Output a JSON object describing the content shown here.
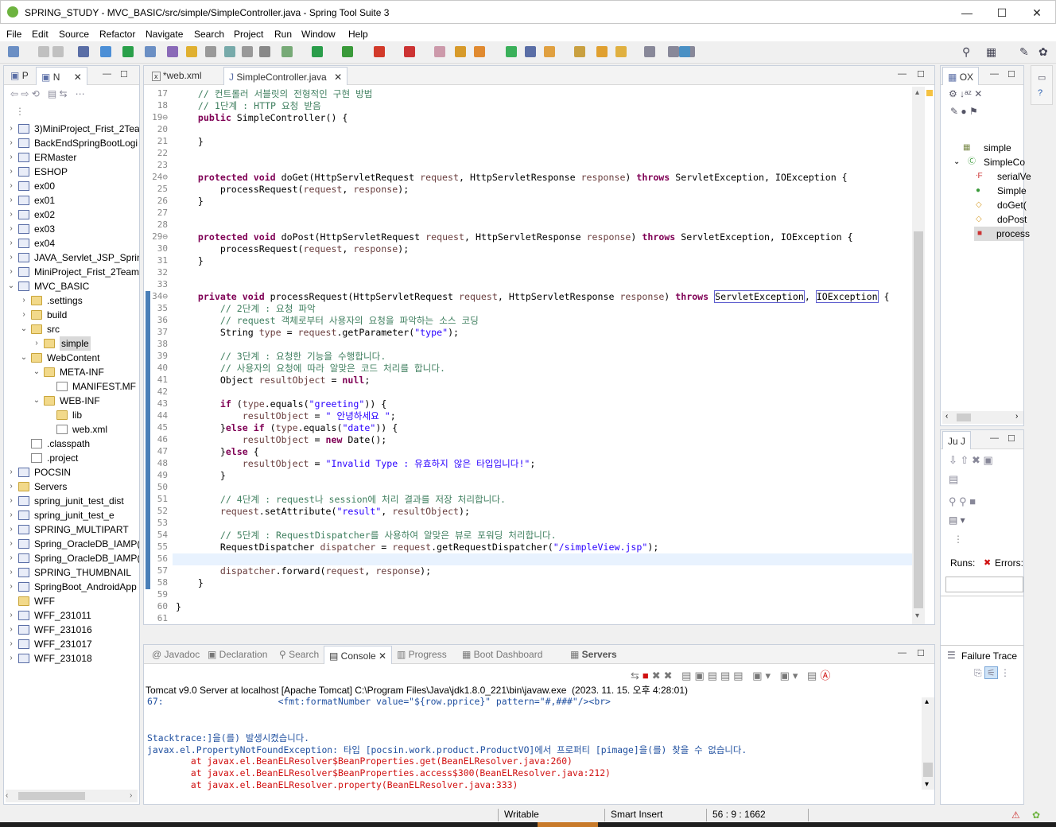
{
  "window": {
    "title": "SPRING_STUDY - MVC_BASIC/src/simple/SimpleController.java - Spring Tool Suite 3",
    "minimize": "—",
    "maximize": "☐",
    "close": "✕"
  },
  "menu": [
    "File",
    "Edit",
    "Source",
    "Refactor",
    "Navigate",
    "Search",
    "Project",
    "Run",
    "Window",
    "Help"
  ],
  "left_panel": {
    "tabs": [
      "P",
      "N"
    ],
    "tree": [
      {
        "label": "3)MiniProject_Frist_2Tea",
        "kind": "proj",
        "indent": 0,
        "arrow": ">"
      },
      {
        "label": "BackEndSpringBootLogi",
        "kind": "proj",
        "indent": 0,
        "arrow": ">"
      },
      {
        "label": "ERMaster",
        "kind": "proj",
        "indent": 0,
        "arrow": ">"
      },
      {
        "label": "ESHOP",
        "kind": "proj",
        "indent": 0,
        "arrow": ">"
      },
      {
        "label": "ex00",
        "kind": "proj",
        "indent": 0,
        "arrow": ">"
      },
      {
        "label": "ex01",
        "kind": "proj",
        "indent": 0,
        "arrow": ">"
      },
      {
        "label": "ex02",
        "kind": "proj",
        "indent": 0,
        "arrow": ">"
      },
      {
        "label": "ex03",
        "kind": "proj",
        "indent": 0,
        "arrow": ">"
      },
      {
        "label": "ex04",
        "kind": "proj",
        "indent": 0,
        "arrow": ">"
      },
      {
        "label": "JAVA_Servlet_JSP_Spring",
        "kind": "proj",
        "indent": 0,
        "arrow": ">"
      },
      {
        "label": "MiniProject_Frist_2Team",
        "kind": "proj",
        "indent": 0,
        "arrow": ">"
      },
      {
        "label": "MVC_BASIC",
        "kind": "proj",
        "indent": 0,
        "arrow": "v"
      },
      {
        "label": ".settings",
        "kind": "folder",
        "indent": 1,
        "arrow": ">"
      },
      {
        "label": "build",
        "kind": "folder",
        "indent": 1,
        "arrow": ">"
      },
      {
        "label": "src",
        "kind": "folder",
        "indent": 1,
        "arrow": "v"
      },
      {
        "label": "simple",
        "kind": "folder",
        "indent": 2,
        "arrow": ">",
        "selected": true
      },
      {
        "label": "WebContent",
        "kind": "folder",
        "indent": 1,
        "arrow": "v"
      },
      {
        "label": "META-INF",
        "kind": "folder",
        "indent": 2,
        "arrow": "v"
      },
      {
        "label": "MANIFEST.MF",
        "kind": "file",
        "indent": 3,
        "arrow": ""
      },
      {
        "label": "WEB-INF",
        "kind": "folder",
        "indent": 2,
        "arrow": "v"
      },
      {
        "label": "lib",
        "kind": "folder",
        "indent": 3,
        "arrow": ""
      },
      {
        "label": "web.xml",
        "kind": "file",
        "indent": 3,
        "arrow": ""
      },
      {
        "label": ".classpath",
        "kind": "file",
        "indent": 1,
        "arrow": ""
      },
      {
        "label": ".project",
        "kind": "file",
        "indent": 1,
        "arrow": ""
      },
      {
        "label": "POCSIN",
        "kind": "proj",
        "indent": 0,
        "arrow": ">"
      },
      {
        "label": "Servers",
        "kind": "folder",
        "indent": 0,
        "arrow": ">"
      },
      {
        "label": "spring_junit_test_dist",
        "kind": "proj",
        "indent": 0,
        "arrow": ">"
      },
      {
        "label": "spring_junit_test_e",
        "kind": "proj",
        "indent": 0,
        "arrow": ">"
      },
      {
        "label": "SPRING_MULTIPART",
        "kind": "proj",
        "indent": 0,
        "arrow": ">"
      },
      {
        "label": "Spring_OracleDB_IAMP(",
        "kind": "proj",
        "indent": 0,
        "arrow": ">"
      },
      {
        "label": "Spring_OracleDB_IAMP(",
        "kind": "proj",
        "indent": 0,
        "arrow": ">"
      },
      {
        "label": "SPRING_THUMBNAIL",
        "kind": "proj",
        "indent": 0,
        "arrow": ">"
      },
      {
        "label": "SpringBoot_AndroidApp",
        "kind": "proj",
        "indent": 0,
        "arrow": ">"
      },
      {
        "label": "WFF",
        "kind": "folder",
        "indent": 0,
        "arrow": ""
      },
      {
        "label": "WFF_231011",
        "kind": "proj",
        "indent": 0,
        "arrow": ">"
      },
      {
        "label": "WFF_231016",
        "kind": "proj",
        "indent": 0,
        "arrow": ">"
      },
      {
        "label": "WFF_231017",
        "kind": "proj",
        "indent": 0,
        "arrow": ">"
      },
      {
        "label": "WFF_231018",
        "kind": "proj",
        "indent": 0,
        "arrow": ">"
      }
    ]
  },
  "editor": {
    "tabs": [
      {
        "label": "*web.xml",
        "active": false
      },
      {
        "label": "SimpleController.java",
        "active": true
      }
    ],
    "lines": [
      {
        "n": "17",
        "html": "    <span class='cm'>// 컨트롤러 서블릿의 전형적인 구현 방법</span>"
      },
      {
        "n": "18",
        "html": "    <span class='cm'>// 1단계 : HTTP 요청 받음</span>"
      },
      {
        "n": "19⊖",
        "html": "    <span class='kw'>public</span> SimpleController() {"
      },
      {
        "n": "20",
        "html": ""
      },
      {
        "n": "21",
        "html": "    }"
      },
      {
        "n": "22",
        "html": ""
      },
      {
        "n": "23",
        "html": ""
      },
      {
        "n": "24⊖",
        "html": "    <span class='kw'>protected</span> <span class='kw'>void</span> doGet(HttpServletRequest <span class='var'>request</span>, HttpServletResponse <span class='var'>response</span>) <span class='kw'>throws</span> ServletException, IOException {"
      },
      {
        "n": "25",
        "html": "        processRequest(<span class='var'>request</span>, <span class='var'>response</span>);"
      },
      {
        "n": "26",
        "html": "    }"
      },
      {
        "n": "27",
        "html": ""
      },
      {
        "n": "28",
        "html": ""
      },
      {
        "n": "29⊖",
        "html": "    <span class='kw'>protected</span> <span class='kw'>void</span> doPost(HttpServletRequest <span class='var'>request</span>, HttpServletResponse <span class='var'>response</span>) <span class='kw'>throws</span> ServletException, IOException {"
      },
      {
        "n": "30",
        "html": "        processRequest(<span class='var'>request</span>, <span class='var'>response</span>);"
      },
      {
        "n": "31",
        "html": "    }"
      },
      {
        "n": "32",
        "html": ""
      },
      {
        "n": "33",
        "html": ""
      },
      {
        "n": "34⊖",
        "html": "    <span class='kw'>private</span> <span class='kw'>void</span> processRequest(HttpServletRequest <span class='var'>request</span>, HttpServletResponse <span class='var'>response</span>) <span class='kw'>throws</span> <span class='ul'>ServletException</span>, <span class='ul'>IOException</span> {"
      },
      {
        "n": "35",
        "html": "        <span class='cm'>// 2단계 : 요청 파악</span>"
      },
      {
        "n": "36",
        "html": "        <span class='cm'>// request 객체로부터 사용자의 요청을 파악하는 소스 코딩</span>"
      },
      {
        "n": "37",
        "html": "        String <span class='var'>type</span> = <span class='var'>request</span>.getParameter(<span class='st'>\"type\"</span>);"
      },
      {
        "n": "38",
        "html": ""
      },
      {
        "n": "39",
        "html": "        <span class='cm'>// 3단계 : 요청한 기능을 수행합니다.</span>"
      },
      {
        "n": "40",
        "html": "        <span class='cm'>// 사용자의 요청에 따라 알맞은 코드 처리를 합니다.</span>"
      },
      {
        "n": "41",
        "html": "        Object <span class='var'>resultObject</span> = <span class='kw'>null</span>;"
      },
      {
        "n": "42",
        "html": ""
      },
      {
        "n": "43",
        "html": "        <span class='kw'>if</span> (<span class='var'>type</span>.equals(<span class='st'>\"greeting\"</span>)) {"
      },
      {
        "n": "44",
        "html": "            <span class='var'>resultObject</span> = <span class='st'>\" 안녕하세요 \"</span>;"
      },
      {
        "n": "45",
        "html": "        }<span class='kw'>else</span> <span class='kw'>if</span> (<span class='var'>type</span>.equals(<span class='st'>\"date\"</span>)) {"
      },
      {
        "n": "46",
        "html": "            <span class='var'>resultObject</span> = <span class='kw'>new</span> Date();"
      },
      {
        "n": "47",
        "html": "        }<span class='kw'>else</span> {"
      },
      {
        "n": "48",
        "html": "            <span class='var'>resultObject</span> = <span class='st'>\"Invalid Type : 유효하지 않은 타입입니다!\"</span>;"
      },
      {
        "n": "49",
        "html": "        }"
      },
      {
        "n": "50",
        "html": ""
      },
      {
        "n": "51",
        "html": "        <span class='cm'>// 4단계 : request나 session에 처리 결과를 저장 처리합니다.</span>"
      },
      {
        "n": "52",
        "html": "        <span class='var'>request</span>.setAttribute(<span class='st'>\"result\"</span>, <span class='var'>resultObject</span>);"
      },
      {
        "n": "53",
        "html": ""
      },
      {
        "n": "54",
        "html": "        <span class='cm'>// 5단계 : RequestDispatcher를 사용하여 알맞은 뷰로 포워딩 처리합니다.</span>"
      },
      {
        "n": "55",
        "html": "        RequestDispatcher <span class='var'>dispatcher</span> = <span class='var'>request</span>.getRequestDispatcher(<span class='st'>\"/simpleView.jsp\"</span>);"
      },
      {
        "n": "56",
        "html": ""
      },
      {
        "n": "57",
        "html": "        <span class='var'>dispatcher</span>.forward(<span class='var'>request</span>, <span class='var'>response</span>);"
      },
      {
        "n": "58",
        "html": "    }"
      },
      {
        "n": "59",
        "html": ""
      },
      {
        "n": "60",
        "html": "}"
      },
      {
        "n": "61",
        "html": ""
      }
    ]
  },
  "outline": {
    "tabs": [
      "O",
      "X"
    ],
    "items": [
      {
        "label": "simple"
      },
      {
        "label": "SimpleCo"
      },
      {
        "label": "serialVe"
      },
      {
        "label": "Simple"
      },
      {
        "label": "doGet("
      },
      {
        "label": "doPost"
      },
      {
        "label": "process"
      }
    ]
  },
  "junit": {
    "tab": "Ju J",
    "runs_label": "Runs:",
    "errors_label": "Errors:",
    "failure_trace": "Failure Trace"
  },
  "bottom": {
    "tabs": [
      {
        "label": "Javadoc"
      },
      {
        "label": "Declaration"
      },
      {
        "label": "Search"
      },
      {
        "label": "Console",
        "active": true
      },
      {
        "label": "Progress"
      },
      {
        "label": "Boot Dashboard"
      },
      {
        "label": "Servers"
      }
    ],
    "server_line": "Tomcat v9.0 Server at localhost [Apache Tomcat] C:\\Program Files\\Java\\jdk1.8.0_221\\bin\\javaw.exe  (2023. 11. 15. 오후 4:28:01)",
    "console_lines": [
      {
        "cls": "info",
        "text": "67:                     <fmt:formatNumber value=\"${row.pprice}\" pattern=\"#,###\"/><br>"
      },
      {
        "cls": "",
        "text": ""
      },
      {
        "cls": "",
        "text": ""
      },
      {
        "cls": "info",
        "text": "Stacktrace:]을(를) 발생시켰습니다."
      },
      {
        "cls": "info",
        "text": "javax.el.PropertyNotFoundException: 타입 [pocsin.work.product.ProductVO]에서 프로퍼티 [pimage]을(를) 찾을 수 없습니다."
      },
      {
        "cls": "err",
        "text": "        at javax.el.BeanELResolver$BeanProperties.get(BeanELResolver.java:260)"
      },
      {
        "cls": "err",
        "text": "        at javax.el.BeanELResolver$BeanProperties.access$300(BeanELResolver.java:212)"
      },
      {
        "cls": "err",
        "text": "        at javax.el.BeanELResolver.property(BeanELResolver.java:333)"
      }
    ]
  },
  "status": {
    "writable": "Writable",
    "insert": "Smart Insert",
    "position": "56 : 9 : 1662"
  }
}
